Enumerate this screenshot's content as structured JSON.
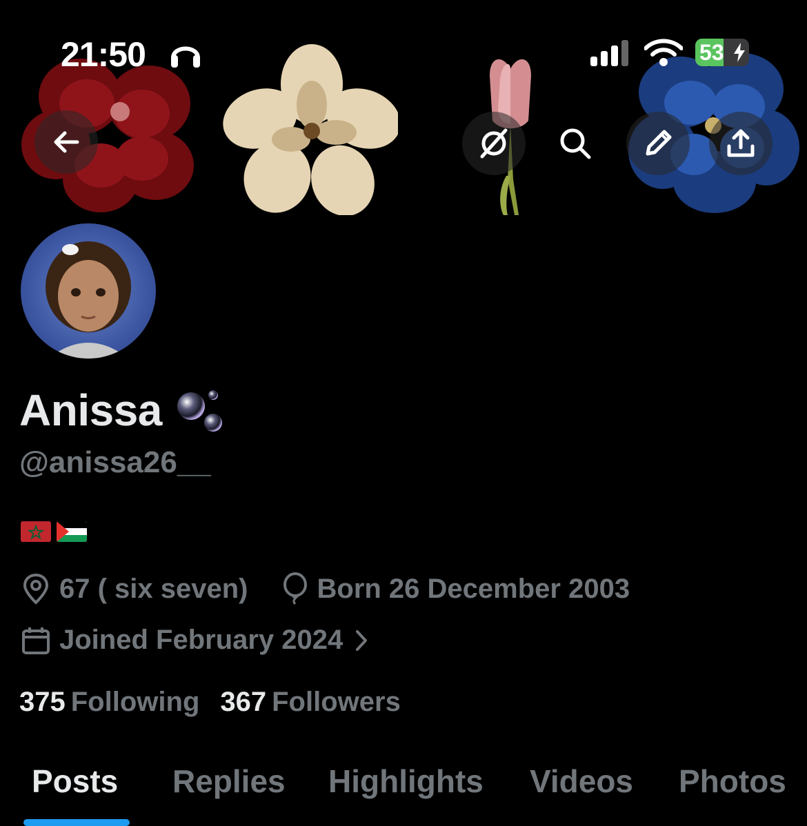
{
  "status_bar": {
    "time": "21:50",
    "battery_level": "53",
    "battery_percent": 53,
    "icons": [
      "headphones-icon",
      "signal-icon",
      "wifi-icon",
      "battery-charging-icon"
    ]
  },
  "nav": {
    "icons": [
      "back-arrow-icon",
      "grok-icon",
      "search-icon",
      "edit-pencil-icon",
      "share-icon"
    ]
  },
  "profile": {
    "display_name": "Anissa",
    "name_emoji": "bubbles-icon",
    "handle": "@anissa26__",
    "bio_flags": [
      "morocco-flag",
      "palestine-flag"
    ],
    "location": "67 ( six seven)",
    "birthday": "Born 26 December 2003",
    "joined": "Joined February 2024",
    "following_count": "375",
    "following_label": "Following",
    "followers_count": "367",
    "followers_label": "Followers"
  },
  "tabs": [
    {
      "label": "Posts",
      "active": true
    },
    {
      "label": "Replies",
      "active": false
    },
    {
      "label": "Highlights",
      "active": false
    },
    {
      "label": "Videos",
      "active": false
    },
    {
      "label": "Photos",
      "active": false
    }
  ],
  "colors": {
    "background": "#000000",
    "text_primary": "#e7e9ea",
    "text_secondary": "#71767b",
    "accent": "#1d9bf0",
    "battery_green": "#5ac45f"
  }
}
